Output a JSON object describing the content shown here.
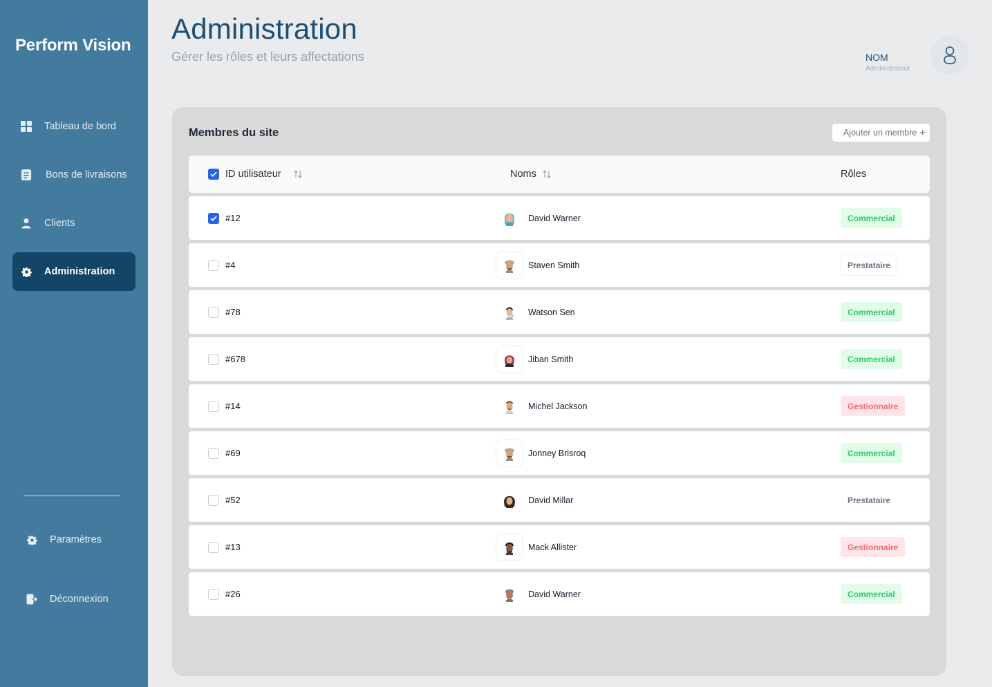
{
  "sidebar": {
    "brand": "Perform Vision",
    "items": [
      {
        "label": "Tableau de bord",
        "icon": "dashboard-icon"
      },
      {
        "label": "Bons de livraisons",
        "icon": "document-icon"
      },
      {
        "label": "Clients",
        "icon": "user-icon"
      },
      {
        "label": "Administration",
        "icon": "gear-icon",
        "active": true
      }
    ],
    "bottom_items": [
      {
        "label": "Paramètres",
        "icon": "gear-icon"
      },
      {
        "label": "Déconnexion",
        "icon": "logout-icon"
      }
    ]
  },
  "header": {
    "title": "Administration",
    "subtitle": "Gérer les rôles et leurs affectations",
    "user_name": "NOM",
    "user_role": "Administrateur"
  },
  "panel": {
    "title": "Membres du site",
    "add_button": "Ajouter un membre",
    "add_button_icon": "+",
    "columns": {
      "id": "ID utilisateur",
      "name": "Noms",
      "role": "Rôles"
    },
    "header_checked": true,
    "rows": [
      {
        "id": "#12",
        "name": "David Warner",
        "role": "Commercial",
        "checked": true
      },
      {
        "id": "#4",
        "name": "Staven Smith",
        "role": "Prestataire",
        "checked": false
      },
      {
        "id": "#78",
        "name": "Watson Sen",
        "role": "Commercial",
        "checked": false
      },
      {
        "id": "#678",
        "name": "Jiban Smith",
        "role": "Commercial",
        "checked": false
      },
      {
        "id": "#14",
        "name": "Michel Jackson",
        "role": "Gestionnaire",
        "checked": false
      },
      {
        "id": "#69",
        "name": "Jonney Brisroq",
        "role": "Commercial",
        "checked": false
      },
      {
        "id": "#52",
        "name": "David Millar",
        "role": "Prestataire",
        "checked": false
      },
      {
        "id": "#13",
        "name": "Mack Allister",
        "role": "Gestionnaire",
        "checked": false
      },
      {
        "id": "#26",
        "name": "David Warner",
        "role": "Commercial",
        "checked": false
      }
    ]
  },
  "colors": {
    "sidebar": "#437b9e",
    "sidebar_active": "#134666",
    "title": "#1c4f73",
    "checkbox_active": "#2563eb",
    "commercial": "#30c86b",
    "gestionnaire": "#f06a72",
    "prestataire": "#6b7280"
  }
}
